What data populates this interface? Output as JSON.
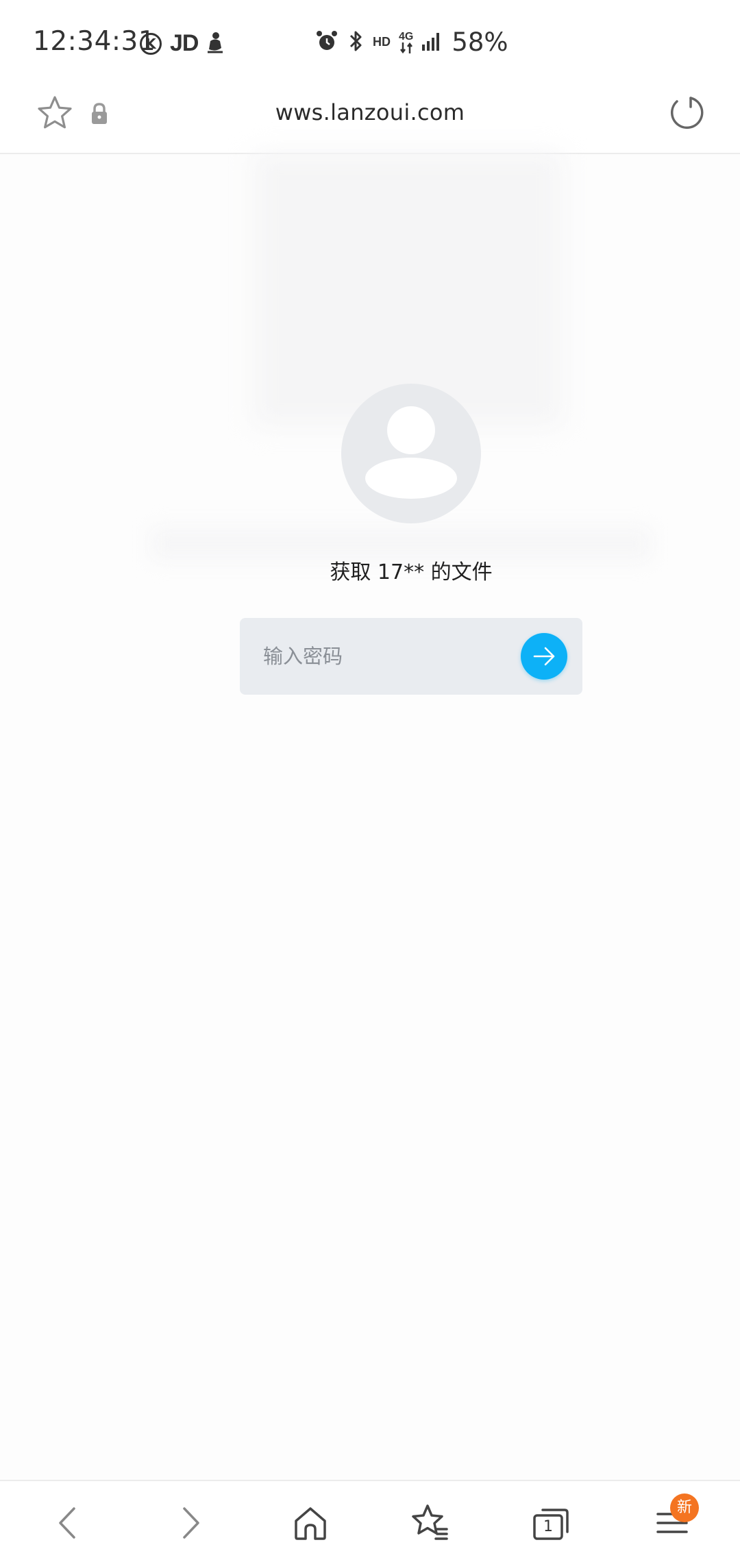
{
  "status_bar": {
    "time": "12:34:31",
    "carrier_label": "JD",
    "network_hd": "HD",
    "network_type": "4G",
    "battery": "58%"
  },
  "address_bar": {
    "url": "wws.lanzoui.com"
  },
  "page": {
    "file_label": "获取 17** 的文件",
    "password_placeholder": "输入密码"
  },
  "toolbar": {
    "tabs_count": "1",
    "menu_badge": "新"
  },
  "colors": {
    "accent": "#0db1f7",
    "badge": "#f47421",
    "input_bg": "#e9ecf0",
    "avatar_bg": "#e8eaed"
  },
  "icons": {
    "status_left": [
      "k-circle-icon",
      "jd-logo",
      "notification-figure-icon"
    ],
    "status_right": [
      "alarm-icon",
      "bluetooth-icon",
      "signal-icon"
    ],
    "address_left": [
      "star-icon",
      "lock-icon"
    ],
    "address_right": [
      "reload-icon"
    ],
    "toolbar": [
      "back-icon",
      "forward-icon",
      "home-icon",
      "bookmarks-icon",
      "tabs-icon",
      "menu-icon"
    ]
  }
}
